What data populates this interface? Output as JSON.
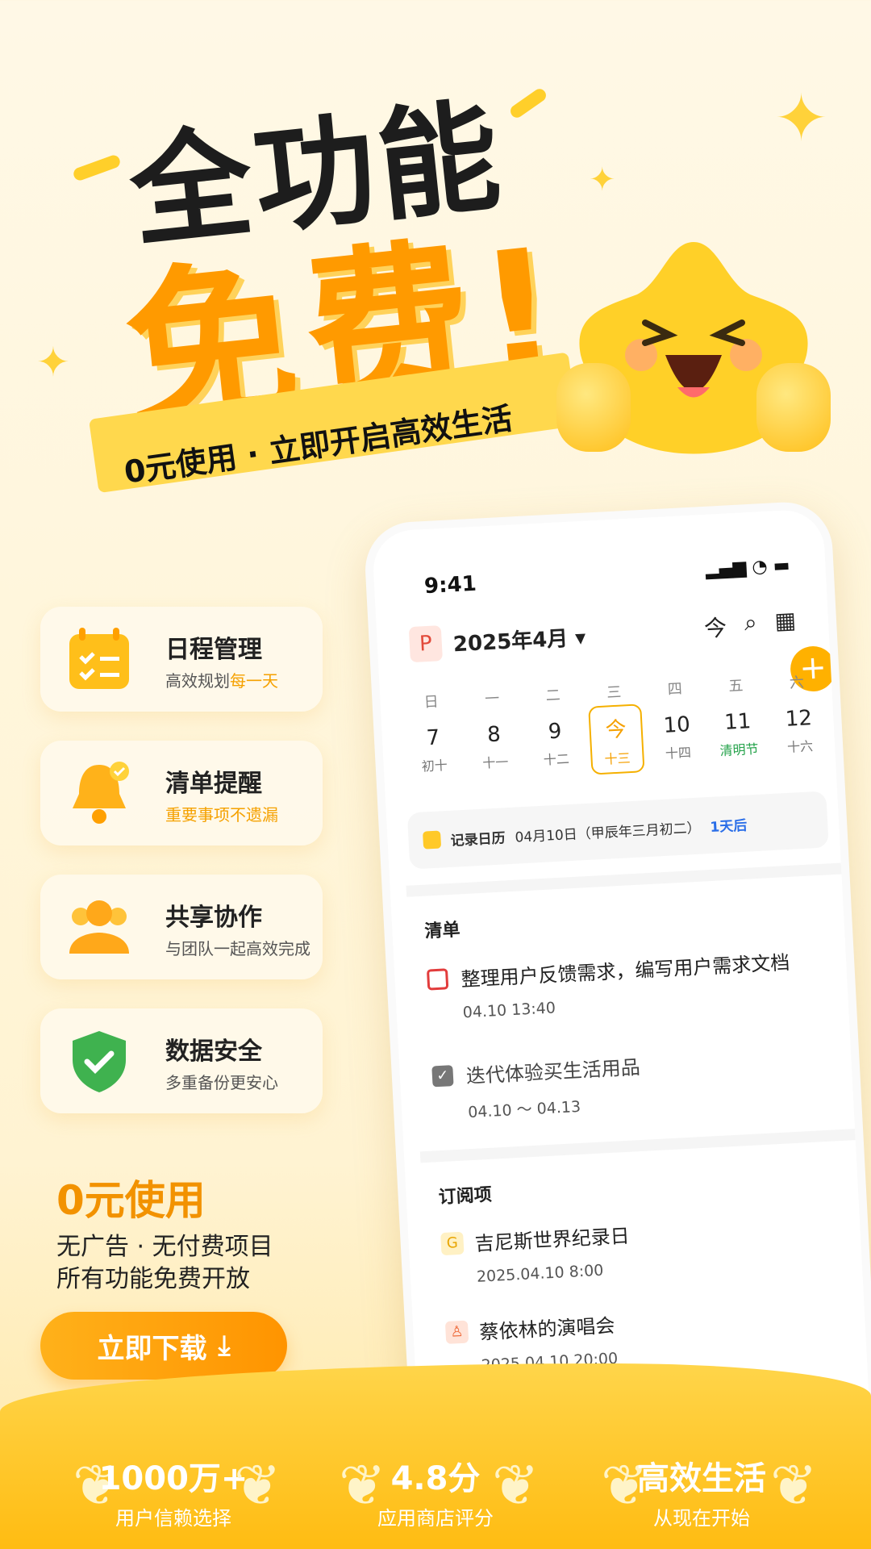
{
  "headline": {
    "line1": "全功能",
    "line2": "免费!",
    "ribbon": "0元使用 · 立即开启高效生活"
  },
  "features": [
    {
      "title": "日程管理",
      "sub_a": "高效规划",
      "sub_b": "每一天",
      "icon": "calendar-icon"
    },
    {
      "title": "清单提醒",
      "sub": "重要事项不遗漏",
      "icon": "bell-icon"
    },
    {
      "title": "共享协作",
      "sub": "与团队一起高效完成",
      "icon": "team-icon"
    },
    {
      "title": "数据安全",
      "sub": "多重备份更安心",
      "icon": "shield-icon"
    }
  ],
  "free": {
    "title": "0元使用",
    "line1": "无广告 · 无付费项目",
    "line2": "所有功能免费开放",
    "download": "立即下载",
    "download_icon": "⤓"
  },
  "phone": {
    "time": "9:41",
    "status": "▂▄▆ ◔ ▬",
    "flag": "P",
    "month": "2025年4月 ▾",
    "top_icons": [
      "今",
      "⌕",
      "▦"
    ],
    "add": "+",
    "week": [
      {
        "d": "日",
        "n": "7",
        "l": "初十"
      },
      {
        "d": "一",
        "n": "8",
        "l": "十一"
      },
      {
        "d": "二",
        "n": "9",
        "l": "十二"
      },
      {
        "d": "三",
        "n": "今",
        "l": "十三"
      },
      {
        "d": "四",
        "n": "10",
        "l": "十四"
      },
      {
        "d": "五",
        "n": "11",
        "l": "清明节"
      },
      {
        "d": "六",
        "n": "12",
        "l": "十六"
      }
    ],
    "record": {
      "label": "记录日历",
      "date": "04月10日（甲辰年三月初二）",
      "after": "1天后"
    },
    "list": {
      "title": "清单",
      "items": [
        {
          "text": "整理用户反馈需求，编写用户需求文档",
          "time": "04.10 13:40"
        },
        {
          "text": "迭代体验买生活用品",
          "time": "04.10 ～ 04.13"
        }
      ]
    },
    "subs": {
      "title": "订阅项",
      "items": [
        {
          "text": "吉尼斯世界纪录日",
          "time": "2025.04.10 8:00",
          "icon": "G"
        },
        {
          "text": "蔡依林的演唱会",
          "time": "2025.04.10 20:00",
          "icon": "♙"
        }
      ]
    }
  },
  "stats": [
    {
      "big": "1000万+",
      "small": "用户信赖选择"
    },
    {
      "big": "4.8分",
      "small": "应用商店评分"
    },
    {
      "big": "高效生活",
      "small": "从现在开始"
    }
  ],
  "colors": {
    "accent": "#ff9a00",
    "brand_yellow": "#ffd23a",
    "green": "#24a24a"
  }
}
